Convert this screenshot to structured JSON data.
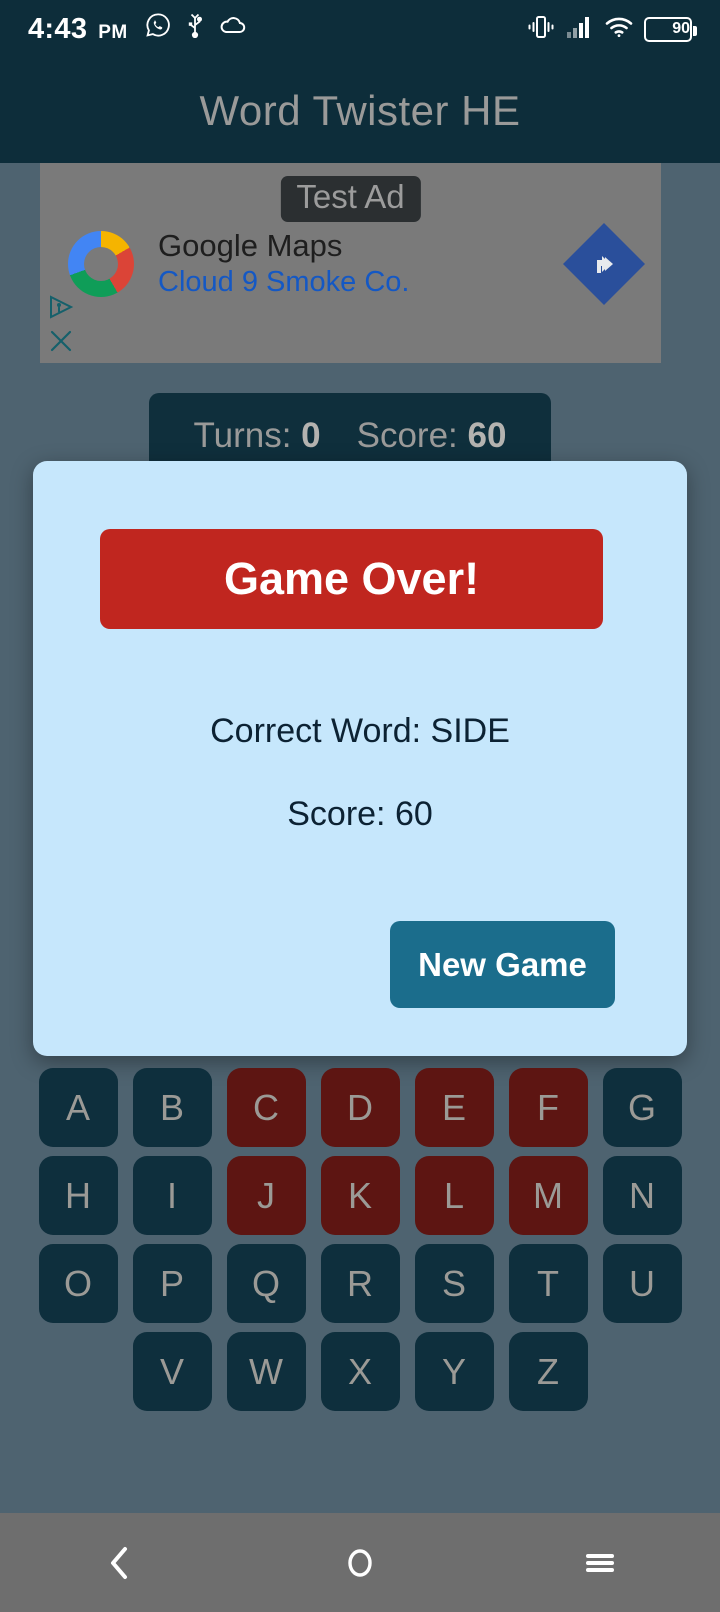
{
  "status_bar": {
    "time": "4:43",
    "ampm": "PM",
    "battery_percent": "90",
    "left_icons": [
      "whatsapp-icon",
      "usb-icon",
      "cloud-icon"
    ],
    "right_icons": [
      "vibrate-icon",
      "signal-icon",
      "wifi-icon",
      "battery-icon"
    ]
  },
  "app_bar": {
    "title": "Word Twister HE"
  },
  "ad": {
    "badge": "Test Ad",
    "advertiser": "Google Maps",
    "headline": "Cloud 9 Smoke Co.",
    "cta_icon": "navigation-arrow-icon",
    "adchoices_icon": "adchoices-icon",
    "close_icon": "close-icon"
  },
  "game_status": {
    "turns_label": "Turns:",
    "turns_value": "0",
    "score_label": "Score:",
    "score_value": "60"
  },
  "dialog": {
    "banner": "Game Over!",
    "correct_word_line": "Correct Word: SIDE",
    "score_line": "Score: 60",
    "new_game_button": "New Game",
    "colors": {
      "background": "#c6e7fc",
      "banner": "#c0261f",
      "button": "#1b6d8c",
      "text": "#0c2233"
    }
  },
  "keyboard": {
    "rows": [
      [
        {
          "letter": "A",
          "used": false
        },
        {
          "letter": "B",
          "used": false
        },
        {
          "letter": "C",
          "used": true
        },
        {
          "letter": "D",
          "used": true
        },
        {
          "letter": "E",
          "used": true
        },
        {
          "letter": "F",
          "used": true
        },
        {
          "letter": "G",
          "used": false
        }
      ],
      [
        {
          "letter": "H",
          "used": false
        },
        {
          "letter": "I",
          "used": false
        },
        {
          "letter": "J",
          "used": true
        },
        {
          "letter": "K",
          "used": true
        },
        {
          "letter": "L",
          "used": true
        },
        {
          "letter": "M",
          "used": true
        },
        {
          "letter": "N",
          "used": false
        }
      ],
      [
        {
          "letter": "O",
          "used": false
        },
        {
          "letter": "P",
          "used": false
        },
        {
          "letter": "Q",
          "used": false
        },
        {
          "letter": "R",
          "used": false
        },
        {
          "letter": "S",
          "used": false
        },
        {
          "letter": "T",
          "used": false
        },
        {
          "letter": "U",
          "used": false
        }
      ],
      [
        {
          "letter": "V",
          "used": false
        },
        {
          "letter": "W",
          "used": false
        },
        {
          "letter": "X",
          "used": false
        },
        {
          "letter": "Y",
          "used": false
        },
        {
          "letter": "Z",
          "used": false
        }
      ]
    ],
    "colors": {
      "key": "#0e2f3d",
      "key_used": "#5d1512",
      "letter": "#9b9a96"
    }
  },
  "nav_bar": {
    "back_icon": "back-chevron-icon",
    "home_icon": "home-circle-icon",
    "recents_icon": "menu-lines-icon"
  }
}
